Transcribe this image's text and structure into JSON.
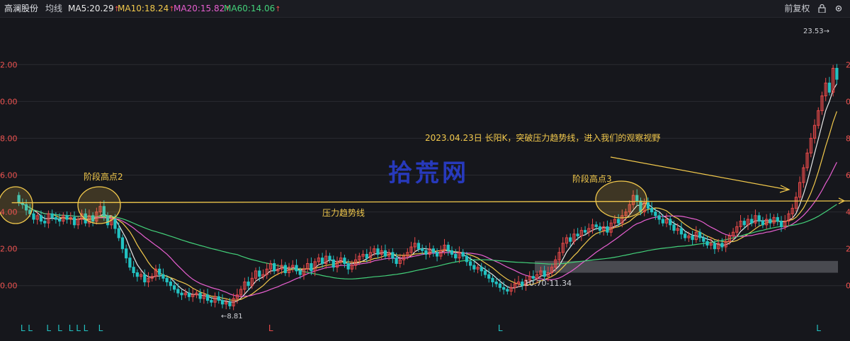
{
  "header": {
    "stock_name": "高澜股份",
    "indicator": "均线",
    "ma": [
      {
        "label": "MA5:20.29",
        "arrow": "↑",
        "color": "#e8e8e8"
      },
      {
        "label": "MA10:18.24",
        "arrow": "↑",
        "color": "#f2c94c"
      },
      {
        "label": "MA20:15.82",
        "arrow": "↑",
        "color": "#e75fd0"
      },
      {
        "label": "MA60:14.06",
        "arrow": "↑",
        "color": "#43d17a"
      }
    ],
    "adjust_label": "前复权",
    "lock_icon": "lock-icon",
    "settings_icon": "settings-icon",
    "arrow_color": "#ef5350"
  },
  "watermark": "拾荒网",
  "annotations": {
    "high2": "阶段高点2",
    "high3": "阶段高点3",
    "trendline": "压力趋势线",
    "breakout": "2023.04.23日 长阳K，突破压力趋势线，进入我们的观察视野",
    "zone": "10.70-11.34",
    "low_label": "8.81",
    "high_label": "23.53"
  },
  "chart_data": {
    "type": "candlestick",
    "title": "",
    "ylim": [
      8.3,
      24.2
    ],
    "y_ticks": [
      10,
      12,
      14,
      16,
      18,
      20,
      22
    ],
    "y_tick_labels": [
      "0.00",
      "2.00",
      "4.00",
      "6.00",
      "8.00",
      "0.00",
      "2.00"
    ],
    "grid": true,
    "trend_line": [
      [
        0,
        14.5
      ],
      [
        225,
        14.6
      ]
    ],
    "support_zone": [
      10.7,
      11.34
    ],
    "markers": {
      "bottom": [
        {
          "i": 1,
          "label": "L"
        },
        {
          "i": 3,
          "label": "L"
        },
        {
          "i": 8,
          "label": "L"
        },
        {
          "i": 11,
          "label": "L"
        },
        {
          "i": 14,
          "label": "L"
        },
        {
          "i": 16,
          "label": "L"
        },
        {
          "i": 18,
          "label": "L"
        },
        {
          "i": 22,
          "label": "L"
        },
        {
          "i": 68,
          "label": "L"
        },
        {
          "i": 130,
          "label": "L"
        },
        {
          "i": 216,
          "label": "L"
        }
      ]
    },
    "series_colors": {
      "up": "#e84a4a",
      "down": "#22c2c2",
      "ma5": "#e8e8e8",
      "ma10": "#f2c94c",
      "ma20": "#e75fd0",
      "ma60": "#43d17a"
    },
    "close": [
      14.5,
      14.4,
      14.1,
      13.9,
      13.6,
      13.8,
      13.5,
      13.4,
      13.9,
      13.7,
      13.6,
      13.5,
      13.8,
      13.6,
      13.7,
      13.3,
      13.6,
      13.9,
      13.4,
      13.8,
      13.5,
      14.0,
      14.3,
      13.8,
      13.3,
      13.6,
      13.1,
      12.6,
      12.0,
      11.5,
      11.0,
      10.7,
      10.5,
      10.6,
      10.2,
      10.4,
      10.5,
      10.9,
      10.6,
      10.4,
      10.2,
      10.0,
      9.8,
      9.6,
      9.5,
      9.6,
      9.4,
      9.5,
      9.6,
      9.3,
      9.5,
      9.2,
      9.1,
      9.4,
      9.2,
      9.0,
      9.1,
      8.9,
      9.3,
      9.5,
      9.8,
      10.2,
      10.0,
      10.4,
      10.8,
      10.5,
      10.6,
      10.9,
      11.2,
      10.8,
      10.9,
      11.1,
      10.7,
      11.0,
      11.1,
      10.8,
      10.6,
      10.9,
      11.2,
      10.8,
      11.3,
      11.5,
      11.2,
      11.6,
      11.4,
      11.0,
      11.3,
      11.5,
      11.2,
      10.9,
      11.1,
      11.4,
      11.6,
      11.7,
      11.5,
      11.8,
      12.0,
      11.7,
      11.9,
      11.6,
      11.8,
      11.5,
      11.2,
      11.4,
      11.6,
      11.8,
      12.1,
      12.3,
      12.0,
      11.9,
      11.7,
      12.0,
      11.8,
      11.6,
      11.9,
      12.2,
      11.9,
      11.7,
      11.5,
      11.8,
      11.6,
      11.3,
      11.1,
      10.9,
      11.0,
      10.8,
      10.6,
      10.4,
      10.2,
      10.1,
      9.9,
      9.8,
      9.7,
      9.9,
      10.1,
      10.2,
      10.0,
      10.3,
      10.5,
      10.4,
      10.6,
      10.8,
      10.5,
      10.7,
      11.0,
      11.4,
      11.8,
      12.3,
      12.6,
      12.4,
      12.8,
      12.7,
      13.0,
      12.9,
      13.1,
      13.3,
      13.2,
      13.0,
      13.2,
      12.9,
      13.4,
      13.6,
      13.4,
      13.8,
      14.0,
      14.4,
      14.9,
      14.6,
      14.0,
      14.5,
      14.2,
      14.0,
      13.8,
      13.6,
      13.4,
      13.6,
      13.3,
      13.0,
      13.1,
      12.8,
      12.6,
      12.7,
      12.5,
      12.9,
      12.6,
      12.4,
      12.2,
      12.3,
      12.0,
      12.3,
      12.1,
      12.4,
      12.7,
      12.9,
      13.2,
      13.5,
      13.3,
      13.6,
      13.4,
      13.8,
      13.5,
      13.3,
      13.6,
      13.4,
      13.7,
      13.5,
      13.2,
      13.5,
      13.9,
      14.2,
      14.8,
      15.6,
      16.4,
      17.2,
      18.0,
      18.7,
      19.5,
      20.3,
      21.0,
      20.5,
      21.8,
      21.2
    ],
    "open": [
      14.9,
      14.5,
      14.4,
      14.1,
      13.9,
      13.6,
      13.8,
      13.5,
      13.4,
      13.9,
      13.7,
      13.6,
      13.5,
      13.8,
      13.6,
      13.7,
      13.3,
      13.6,
      13.9,
      13.4,
      13.8,
      13.5,
      14.0,
      14.3,
      13.8,
      13.3,
      13.6,
      13.1,
      12.6,
      12.0,
      11.5,
      11.0,
      10.7,
      10.5,
      10.6,
      10.2,
      10.4,
      10.5,
      10.9,
      10.6,
      10.4,
      10.2,
      10.0,
      9.8,
      9.6,
      9.5,
      9.6,
      9.4,
      9.5,
      9.6,
      9.3,
      9.5,
      9.2,
      9.1,
      9.4,
      9.2,
      9.0,
      9.1,
      8.9,
      9.3,
      9.5,
      9.8,
      10.2,
      10.0,
      10.4,
      10.8,
      10.5,
      10.6,
      10.9,
      11.2,
      10.8,
      10.9,
      11.1,
      10.7,
      11.0,
      11.1,
      10.8,
      10.6,
      10.9,
      11.2,
      10.8,
      11.3,
      11.5,
      11.2,
      11.6,
      11.4,
      11.0,
      11.3,
      11.5,
      11.2,
      10.9,
      11.1,
      11.4,
      11.6,
      11.7,
      11.5,
      11.8,
      12.0,
      11.7,
      11.9,
      11.6,
      11.8,
      11.5,
      11.2,
      11.4,
      11.6,
      11.8,
      12.1,
      12.3,
      12.0,
      11.9,
      11.7,
      12.0,
      11.8,
      11.6,
      11.9,
      12.2,
      11.9,
      11.7,
      11.5,
      11.8,
      11.6,
      11.3,
      11.1,
      10.9,
      11.0,
      10.8,
      10.6,
      10.4,
      10.2,
      10.1,
      9.9,
      9.8,
      9.7,
      9.9,
      10.1,
      10.2,
      10.0,
      10.3,
      10.5,
      10.4,
      10.6,
      10.8,
      10.5,
      10.7,
      11.0,
      11.4,
      11.8,
      12.3,
      12.6,
      12.4,
      12.8,
      12.7,
      13.0,
      12.9,
      13.1,
      13.3,
      13.2,
      13.0,
      13.2,
      12.9,
      13.4,
      13.6,
      13.4,
      13.8,
      14.0,
      14.4,
      14.9,
      14.6,
      14.0,
      14.5,
      14.2,
      14.0,
      13.8,
      13.6,
      13.4,
      13.6,
      13.3,
      13.0,
      13.1,
      12.8,
      12.6,
      12.7,
      12.5,
      12.9,
      12.6,
      12.4,
      12.2,
      12.3,
      12.0,
      12.3,
      12.1,
      12.4,
      12.7,
      12.9,
      13.2,
      13.5,
      13.3,
      13.6,
      13.4,
      13.8,
      13.5,
      13.3,
      13.6,
      13.4,
      13.7,
      13.5,
      13.2,
      13.5,
      13.9,
      14.2,
      14.8,
      15.6,
      16.4,
      17.2,
      18.0,
      18.7,
      19.5,
      20.3,
      21.0,
      20.5,
      21.8
    ],
    "ma5_final": 20.29,
    "ma10_final": 18.24,
    "ma20_final": 15.82,
    "ma60_final": 14.06
  }
}
